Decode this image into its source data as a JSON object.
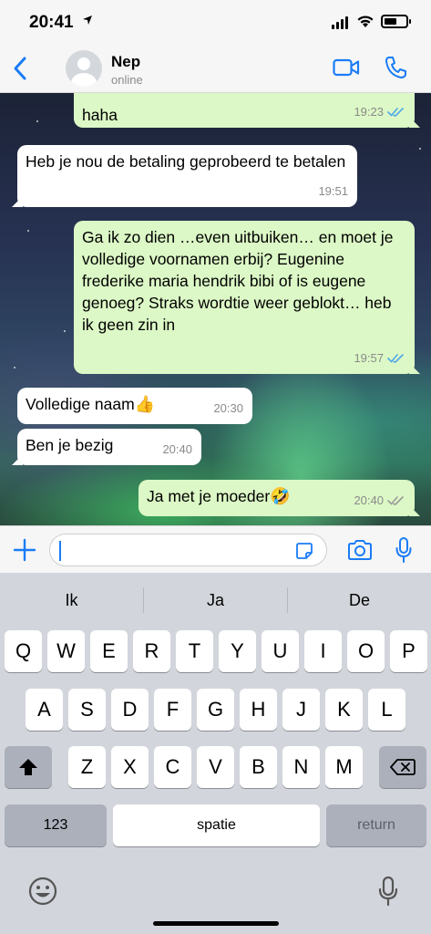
{
  "status_bar": {
    "time": "20:41"
  },
  "header": {
    "contact_name": "Nep",
    "contact_status": "online"
  },
  "messages": [
    {
      "direction": "out",
      "text": "haha",
      "time": "19:23",
      "read": true
    },
    {
      "direction": "in",
      "text": "Heb je nou de betaling geprobeerd te betalen",
      "time": "19:51"
    },
    {
      "direction": "out",
      "text": "Ga ik zo dien …even uitbuiken… en moet je volledige voornamen erbij? Eugenine frederike maria hendrik bibi of is eugene genoeg? Straks wordtie weer geblokt… heb ik geen zin in",
      "time": "19:57",
      "read": true
    },
    {
      "direction": "in",
      "text": "Volledige naam",
      "emoji": "👍",
      "time": "20:30"
    },
    {
      "direction": "in",
      "text": "Ben je bezig",
      "time": "20:40"
    },
    {
      "direction": "out",
      "text": "Ja met je moeder",
      "emoji": "🤣",
      "time": "20:40",
      "read": false
    }
  ],
  "input": {
    "placeholder": ""
  },
  "keyboard": {
    "suggestions": [
      "Ik",
      "Ja",
      "De"
    ],
    "row1": [
      "Q",
      "W",
      "E",
      "R",
      "T",
      "Y",
      "U",
      "I",
      "O",
      "P"
    ],
    "row2": [
      "A",
      "S",
      "D",
      "F",
      "G",
      "H",
      "J",
      "K",
      "L"
    ],
    "row3": [
      "Z",
      "X",
      "C",
      "V",
      "B",
      "N",
      "M"
    ],
    "numbers_label": "123",
    "space_label": "spatie",
    "return_label": "return"
  },
  "colors": {
    "accent": "#1a7cf5",
    "outgoing_bubble": "#dcf8c6",
    "incoming_bubble": "#ffffff",
    "read_ticks": "#4fa8e8"
  },
  "icons": [
    "location-arrow-icon",
    "signal-icon",
    "wifi-icon",
    "battery-icon",
    "back-chevron-icon",
    "avatar-icon",
    "video-call-icon",
    "phone-call-icon",
    "plus-icon",
    "sticker-icon",
    "camera-icon",
    "microphone-icon",
    "shift-icon",
    "backspace-icon",
    "emoji-icon",
    "dictation-icon",
    "double-check-icon"
  ]
}
